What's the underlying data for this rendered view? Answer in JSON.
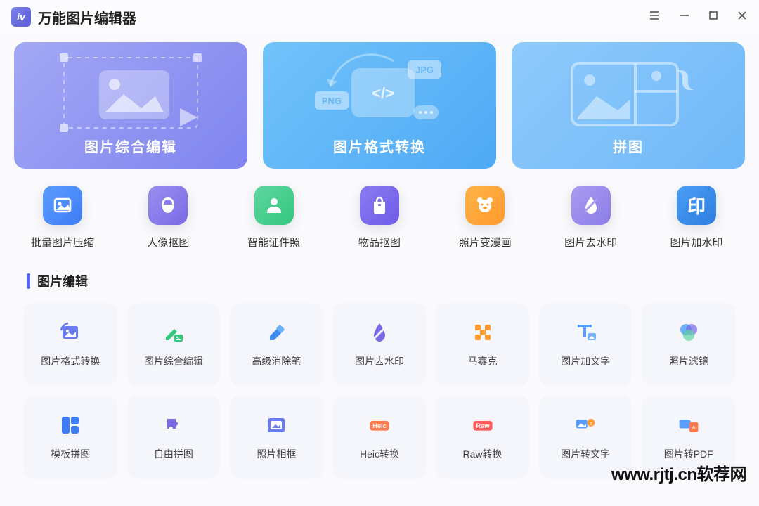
{
  "app": {
    "title": "万能图片编辑器"
  },
  "hero": [
    {
      "label": "图片综合编辑"
    },
    {
      "label": "图片格式转换"
    },
    {
      "label": "拼图"
    }
  ],
  "tools": [
    {
      "label": "批量图片压缩",
      "icon": "image-icon",
      "bg": "bg-blue"
    },
    {
      "label": "人像抠图",
      "icon": "face-icon",
      "bg": "bg-purple"
    },
    {
      "label": "智能证件照",
      "icon": "person-icon",
      "bg": "bg-green"
    },
    {
      "label": "物品抠图",
      "icon": "bag-icon",
      "bg": "bg-violet"
    },
    {
      "label": "照片变漫画",
      "icon": "bear-icon",
      "bg": "bg-orange"
    },
    {
      "label": "图片去水印",
      "icon": "droplet-off-icon",
      "bg": "bg-lilac"
    },
    {
      "label": "图片加水印",
      "icon": "stamp-icon",
      "bg": "bg-blue2",
      "stamp": "印"
    }
  ],
  "section": {
    "title": "图片编辑"
  },
  "grid": [
    {
      "label": "图片格式转换",
      "icon": "convert-icon",
      "color": "#6b7cf0"
    },
    {
      "label": "图片综合编辑",
      "icon": "edit-image-icon",
      "color": "#34c77e"
    },
    {
      "label": "高级消除笔",
      "icon": "eraser-icon",
      "color": "#3e8df5"
    },
    {
      "label": "图片去水印",
      "icon": "droplet-off-icon",
      "color": "#7b6ae6"
    },
    {
      "label": "马赛克",
      "icon": "mosaic-icon",
      "color": "#ff9a2e"
    },
    {
      "label": "图片加文字",
      "icon": "text-image-icon",
      "color": "#5b9dff"
    },
    {
      "label": "照片滤镜",
      "icon": "filter-icon",
      "color": "#4a9ef5"
    },
    {
      "label": "模板拼图",
      "icon": "template-icon",
      "color": "#3e7cf5"
    },
    {
      "label": "自由拼图",
      "icon": "puzzle-icon",
      "color": "#7b6ae6"
    },
    {
      "label": "照片相框",
      "icon": "frame-icon",
      "color": "#6b7cf0"
    },
    {
      "label": "Heic转换",
      "icon": "heic-icon",
      "color": "#ff7a4a",
      "badge": "Heic"
    },
    {
      "label": "Raw转换",
      "icon": "raw-icon",
      "color": "#ff5a5a",
      "badge": "Raw"
    },
    {
      "label": "图片转文字",
      "icon": "img2text-icon",
      "color": "#5b9dff"
    },
    {
      "label": "图片转PDF",
      "icon": "img2pdf-icon",
      "color": "#ff7a4a"
    }
  ],
  "watermark": "www.rjtj.cn软荐网",
  "art": {
    "png": "PNG",
    "jpg": "JPG"
  }
}
